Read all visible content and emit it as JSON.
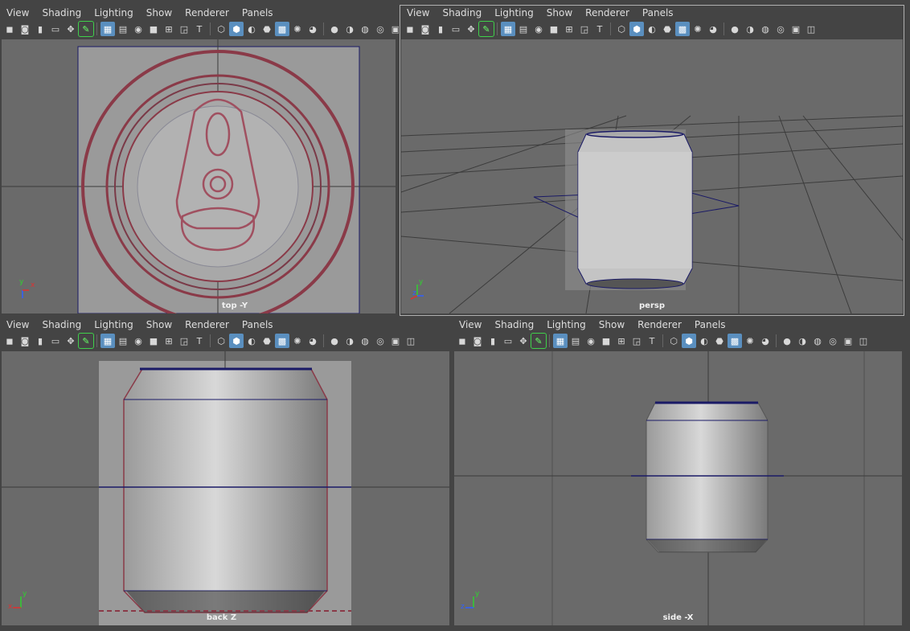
{
  "menu": [
    "View",
    "Shading",
    "Lighting",
    "Show",
    "Renderer",
    "Panels"
  ],
  "toolbar_icons": [
    "camera-select-icon",
    "camera-attr-icon",
    "bookmark-icon",
    "image-plane-icon",
    "2d-pan-icon",
    "grease-pencil-icon",
    "grid-icon",
    "film-gate-icon",
    "resolution-gate-icon",
    "gate-mask-icon",
    "field-chart-icon",
    "safe-action-icon",
    "safe-title-icon",
    "wireframe-icon",
    "smooth-shade-icon",
    "default-material-icon",
    "wireframe-on-shaded-icon",
    "textured-icon",
    "use-lights-icon",
    "shadows-icon",
    "ambient-occlusion-icon",
    "motion-blur-icon",
    "anti-alias-icon",
    "depth-of-field-icon",
    "isolate-select-icon",
    "xray-icon"
  ],
  "panels": {
    "top": {
      "camera": "top -Y",
      "axis": [
        "y",
        "x"
      ]
    },
    "persp": {
      "camera": "persp",
      "axis": [
        "y",
        "z"
      ]
    },
    "back": {
      "camera": "back Z",
      "axis": [
        "y",
        "x"
      ]
    },
    "side": {
      "camera": "side -X",
      "axis": [
        "y",
        "z"
      ]
    }
  },
  "colors": {
    "viewport_bg": "#6a6a6a",
    "ui_bg": "#444444",
    "selection_blue": "#5a8fbf",
    "wire_navy": "#1a1a66",
    "imageplane_red": "#8a3a48",
    "x_axis": "#e03030",
    "y_axis": "#30d030",
    "z_axis": "#3060ff"
  }
}
